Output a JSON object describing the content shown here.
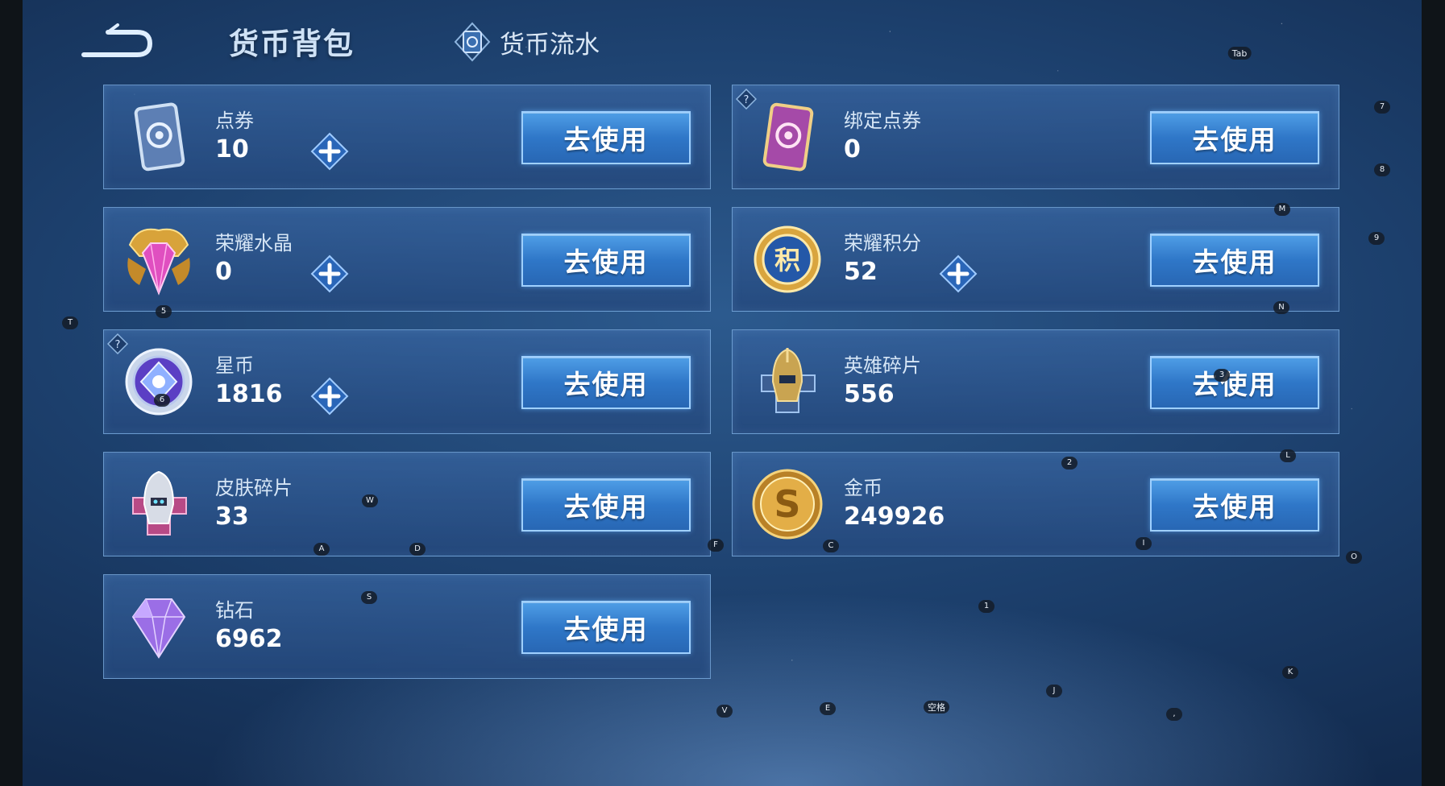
{
  "header": {
    "title": "货币背包",
    "tab_label": "货币流水"
  },
  "cards": [
    {
      "name": "点券",
      "value": "10",
      "button": "去使用"
    },
    {
      "name": "绑定点券",
      "value": "0",
      "button": "去使用"
    },
    {
      "name": "荣耀水晶",
      "value": "0",
      "button": "去使用"
    },
    {
      "name": "荣耀积分",
      "value": "52",
      "button": "去使用"
    },
    {
      "name": "星币",
      "value": "1816",
      "button": "去使用"
    },
    {
      "name": "英雄碎片",
      "value": "556",
      "button": "去使用"
    },
    {
      "name": "皮肤碎片",
      "value": "33",
      "button": "去使用"
    },
    {
      "name": "金币",
      "value": "249926",
      "button": "去使用"
    },
    {
      "name": "钻石",
      "value": "6962",
      "button": "去使用"
    }
  ],
  "key_hints": {
    "tab": "Tab",
    "k7": "7",
    "k8": "8",
    "k9": "9",
    "m": "M",
    "n": "N",
    "t": "T",
    "k5": "5",
    "k6": "6",
    "k3": "3",
    "k2": "2",
    "l": "L",
    "w": "W",
    "a": "A",
    "d": "D",
    "f": "F",
    "c": "C",
    "i": "I",
    "o": "O",
    "s": "S",
    "k1": "1",
    "k": "K",
    "j": "J",
    "v": "V",
    "e": "E",
    "space": "空格",
    "comma": ","
  }
}
